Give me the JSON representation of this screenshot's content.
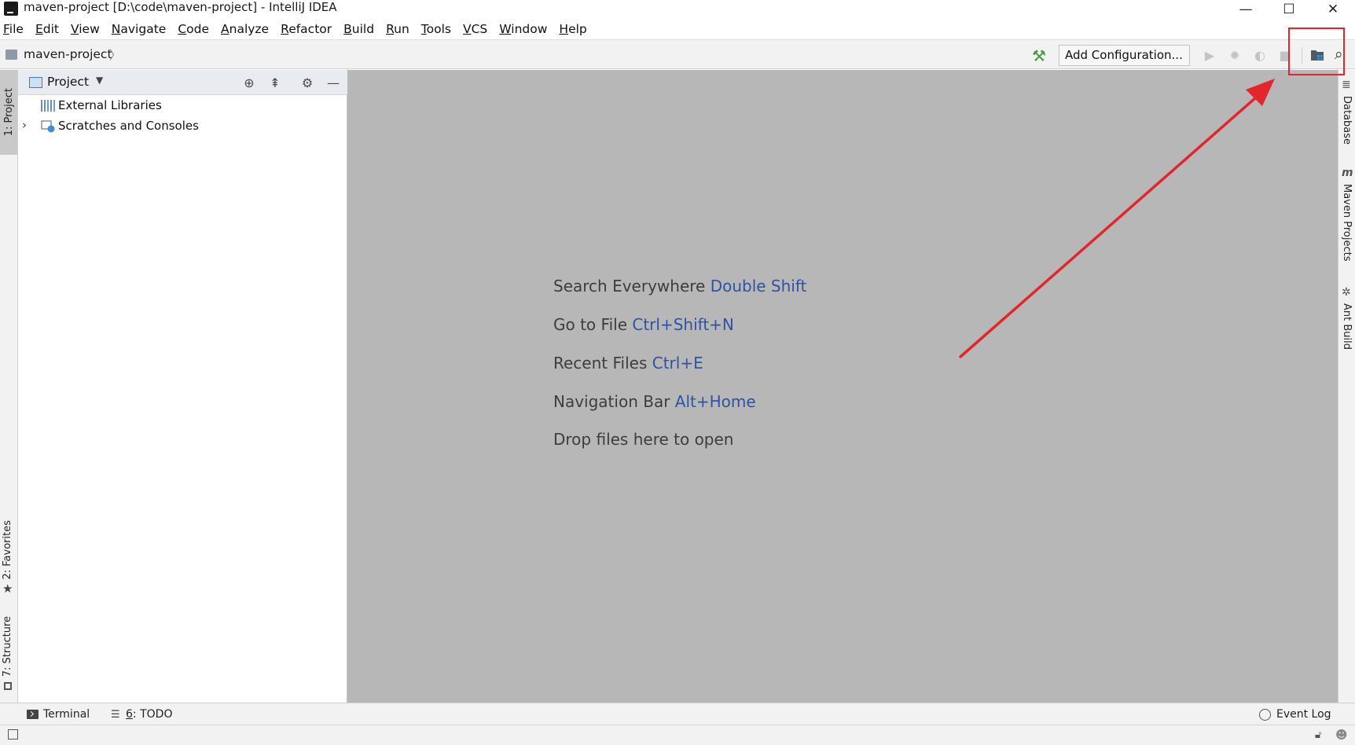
{
  "window": {
    "title": "maven-project [D:\\code\\maven-project] - IntelliJ IDEA",
    "minimize_glyph": "—",
    "maximize_glyph": "☐",
    "close_glyph": "✕"
  },
  "menu": [
    "File",
    "Edit",
    "View",
    "Navigate",
    "Code",
    "Analyze",
    "Refactor",
    "Build",
    "Run",
    "Tools",
    "VCS",
    "Window",
    "Help"
  ],
  "navbar": {
    "breadcrumb": "maven-project",
    "separator": "〉",
    "add_configuration": "Add Configuration..."
  },
  "left_tabs": {
    "project": "1: Project",
    "favorites": "2: Favorites",
    "structure": "7: Structure"
  },
  "project_panel": {
    "title": "Project",
    "dropdown_glyph": "▼",
    "tree": [
      {
        "label": "External Libraries",
        "expandable": false
      },
      {
        "label": "Scratches and Consoles",
        "expandable": true
      }
    ]
  },
  "editor_hints": [
    {
      "text": "Search Everywhere",
      "key": "Double Shift"
    },
    {
      "text": "Go to File",
      "key": "Ctrl+Shift+N"
    },
    {
      "text": "Recent Files",
      "key": "Ctrl+E"
    },
    {
      "text": "Navigation Bar",
      "key": "Alt+Home"
    },
    {
      "text": "Drop files here to open",
      "key": ""
    }
  ],
  "right_tabs": {
    "database": "Database",
    "maven": "Maven Projects",
    "ant": "Ant Build"
  },
  "bottom_tabs": {
    "terminal": "Terminal",
    "todo_num": "6",
    "todo_text": ": TODO",
    "event_log": "Event Log"
  },
  "icons": {
    "hammer": "hammer-icon",
    "run": "run-icon",
    "debug": "debug-icon",
    "coverage": "coverage-icon",
    "stop": "stop-icon",
    "project_structure": "project-structure-icon",
    "search": "search-icon"
  },
  "colors": {
    "shortcut": "#2f52a2",
    "annotation": "#e3262c",
    "editor_bg": "#b7b7b7"
  }
}
